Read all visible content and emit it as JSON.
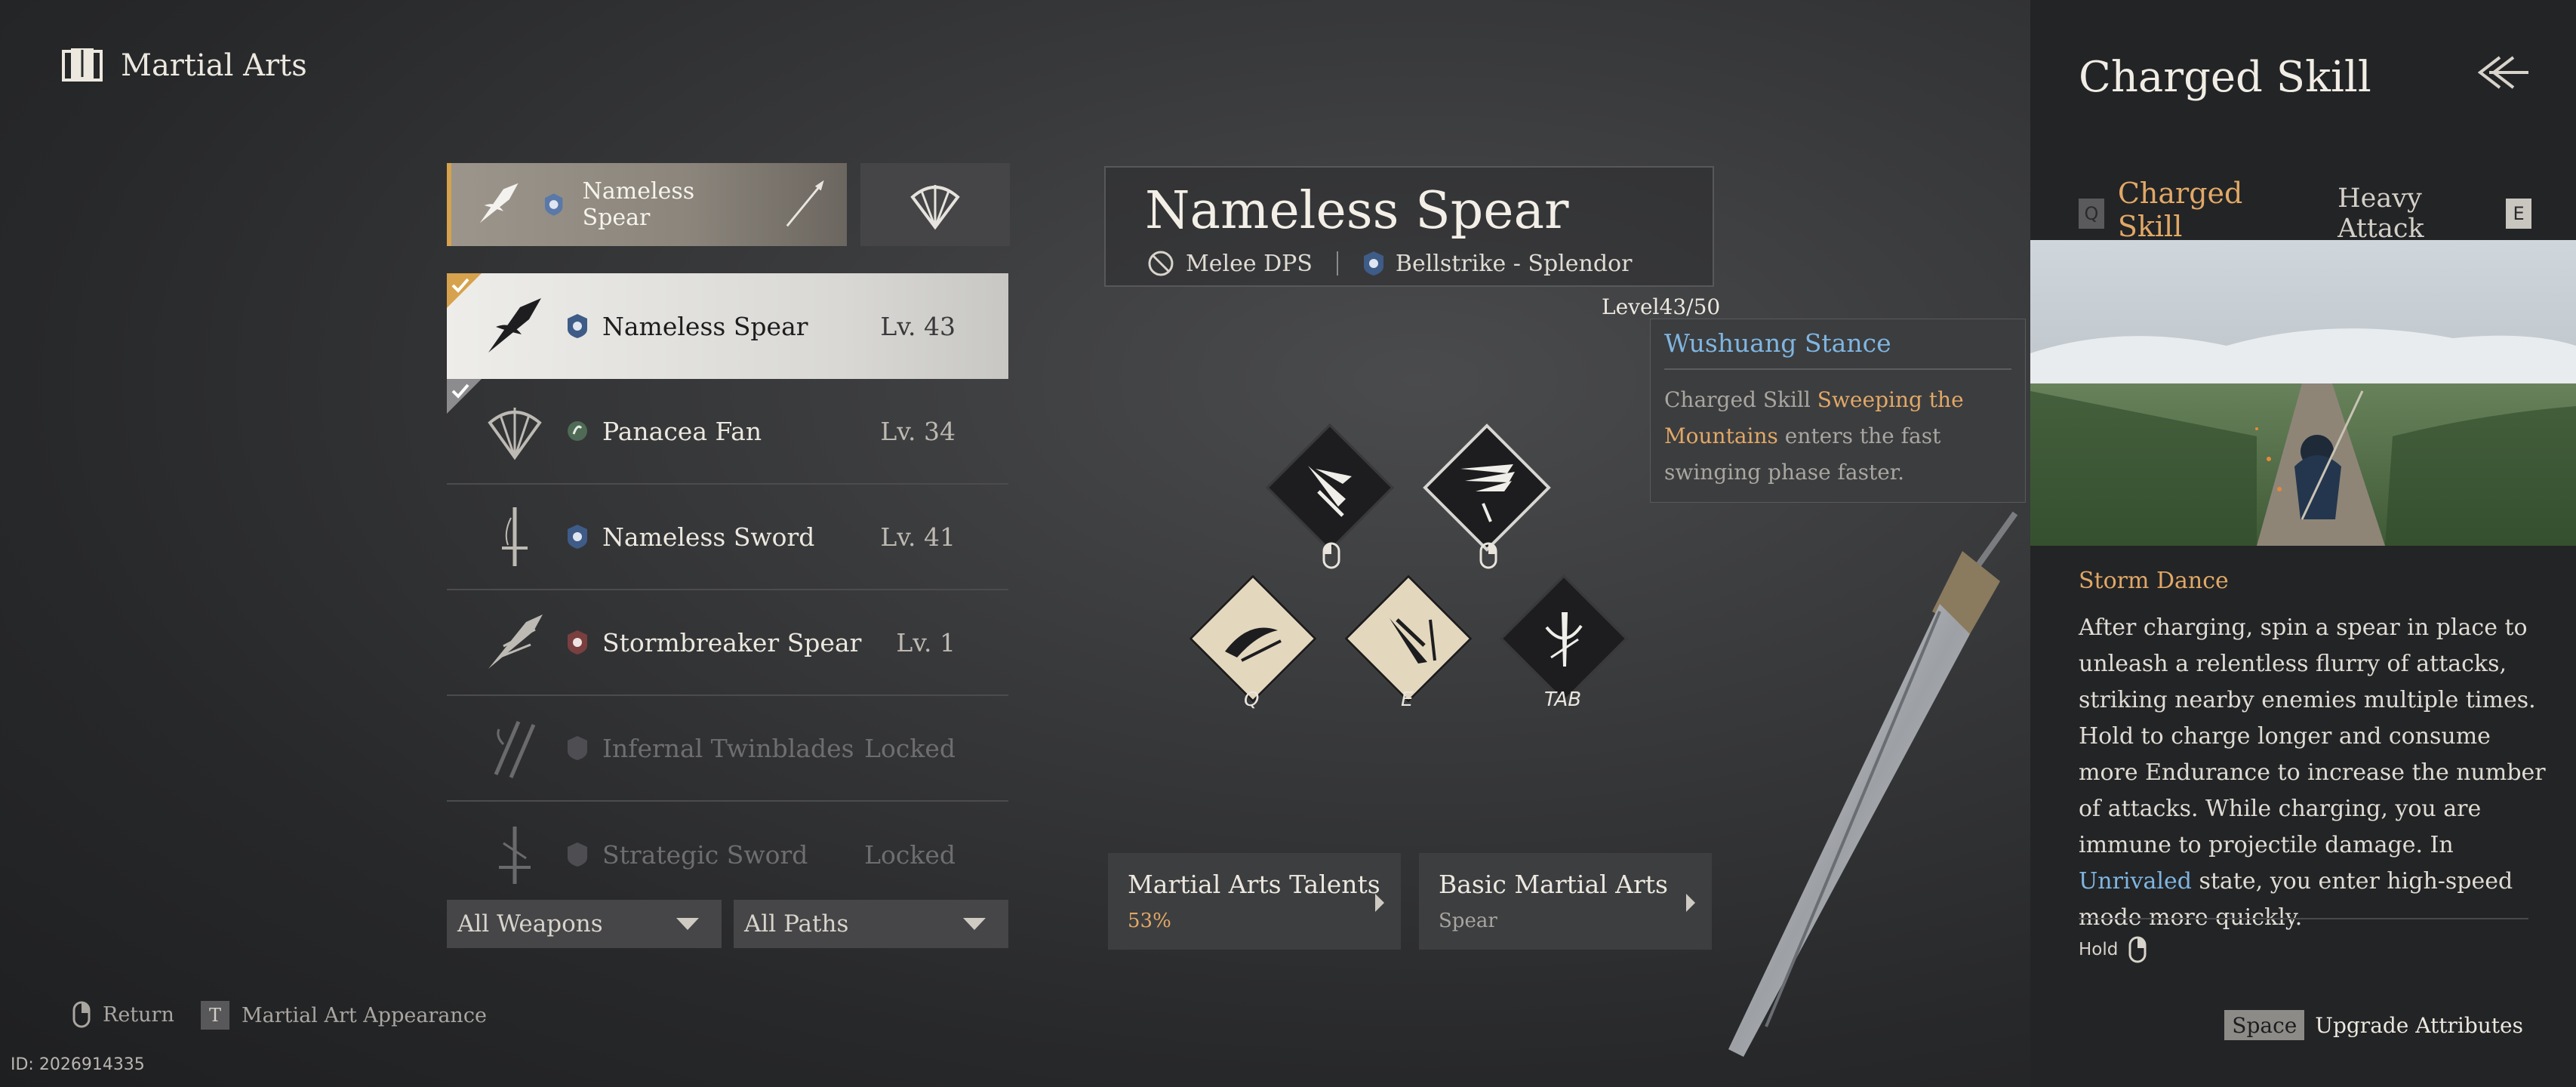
{
  "header": {
    "title": "Martial Arts",
    "icon": "book-icon"
  },
  "weapon_slots": {
    "active_name": "Nameless Spear"
  },
  "weapons": [
    {
      "name": "Nameless Spear",
      "level": "Lv. 43",
      "selected": true,
      "equipped": true
    },
    {
      "name": "Panacea Fan",
      "level": "Lv. 34",
      "equipped": true
    },
    {
      "name": "Nameless Sword",
      "level": "Lv. 41"
    },
    {
      "name": "Stormbreaker Spear",
      "level": "Lv. 1"
    },
    {
      "name": "Infernal Twinblades",
      "level": "Locked",
      "locked": true
    },
    {
      "name": "Strategic Sword",
      "level": "Locked",
      "locked": true
    }
  ],
  "filters": {
    "weapons": "All Weapons",
    "paths": "All Paths"
  },
  "hints": {
    "return_label": "Return",
    "appearance_key": "T",
    "appearance_label": "Martial Art Appearance"
  },
  "page_id": "ID: 2026914335",
  "info": {
    "title": "Nameless Spear",
    "role": "Melee DPS",
    "path": "Bellstrike - Splendor",
    "level": "Level43/50"
  },
  "tooltip": {
    "title": "Wushuang Stance",
    "body_prefix": "Charged Skill ",
    "body_highlight": "Sweeping the Mountains",
    "body_suffix": " enters the fast swinging phase faster."
  },
  "skill_keys": {
    "q": "Q",
    "e": "E",
    "tab": "TAB"
  },
  "buttons": {
    "talents_title": "Martial Arts Talents",
    "talents_progress": "53%",
    "basic_title": "Basic Martial Arts",
    "basic_sub": "Spear"
  },
  "panel": {
    "title": "Charged Skill",
    "tab_left_key": "Q",
    "tab_active": "Charged Skill",
    "tab_inactive": "Heavy Attack",
    "tab_right_key": "E",
    "skill_name": "Storm Dance",
    "desc_part1": " After charging, spin a spear in place to unleash a relentless flurry of attacks, striking nearby enemies multiple times. Hold to charge longer and consume more Endurance to increase the number of attacks. While charging, you are immune to projectile damage. In ",
    "desc_highlight": "Unrivaled",
    "desc_part2": " state, you enter high-speed mode more quickly.",
    "hold_label": "Hold",
    "upgrade_key": "Space",
    "upgrade_label": "Upgrade Attributes"
  },
  "colors": {
    "accent_gold": "#e1a866",
    "accent_blue": "#7fb6e2",
    "slot_border": "#d6a24d"
  }
}
